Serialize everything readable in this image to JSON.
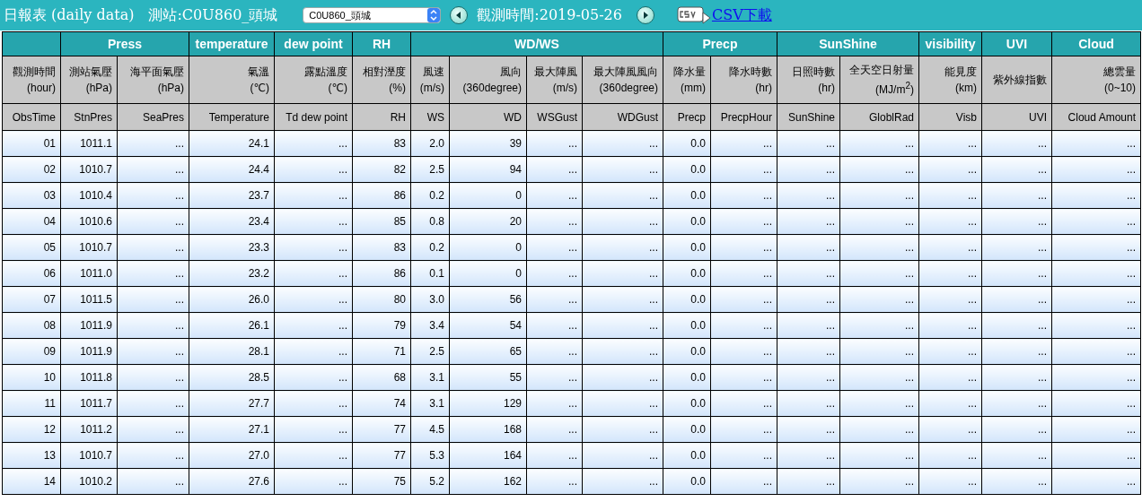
{
  "top_bar": {
    "title": "日報表 (daily data)",
    "station_label": "測站:C0U860_頭城",
    "station_select": {
      "value": "C0U860_頭城"
    },
    "date_label": "觀測時間:2019-05-26",
    "csv_link": "CSV下載"
  },
  "table": {
    "groups": [
      {
        "columns": [
          {
            "label": "觀測時間\n(hour)",
            "code": "ObsTime"
          }
        ]
      },
      {
        "label": "Press",
        "columns": [
          {
            "label": "測站氣壓\n(hPa)",
            "code": "StnPres"
          },
          {
            "label": "海平面氣壓\n(hPa)",
            "code": "SeaPres"
          }
        ]
      },
      {
        "label": "temperature",
        "columns": [
          {
            "label": "氣溫\n(℃)",
            "code": "Temperature"
          }
        ]
      },
      {
        "label": "dew point",
        "columns": [
          {
            "label": "露點溫度\n(℃)",
            "code": "Td dew point"
          }
        ]
      },
      {
        "label": "RH",
        "columns": [
          {
            "label": "相對溼度\n(%)",
            "code": "RH"
          }
        ]
      },
      {
        "label": "WD/WS",
        "columns": [
          {
            "label": "風速\n(m/s)",
            "code": "WS"
          },
          {
            "label": "風向\n(360degree)",
            "code": "WD"
          },
          {
            "label": "最大陣風\n(m/s)",
            "code": "WSGust"
          },
          {
            "label": "最大陣風風向\n(360degree)",
            "code": "WDGust"
          }
        ]
      },
      {
        "label": "Precp",
        "columns": [
          {
            "label": "降水量\n(mm)",
            "code": "Precp"
          },
          {
            "label": "降水時數\n(hr)",
            "code": "PrecpHour"
          }
        ]
      },
      {
        "label": "SunShine",
        "columns": [
          {
            "label": "日照時數\n(hr)",
            "code": "SunShine"
          },
          {
            "label": "全天空日射量\n(MJ/m$^{2}$)",
            "code": "GloblRad"
          }
        ]
      },
      {
        "label": "visibility",
        "columns": [
          {
            "label": "能見度\n(km)",
            "code": "Visb"
          }
        ]
      },
      {
        "label": "UVI",
        "columns": [
          {
            "label": "紫外線指數",
            "code": "UVI"
          }
        ]
      },
      {
        "label": "Cloud",
        "columns": [
          {
            "label": "總雲量\n(0~10)",
            "code": "Cloud Amount"
          }
        ]
      }
    ],
    "rows": [
      [
        "01",
        "1011.1",
        "...",
        "24.1",
        "...",
        "83",
        "2.0",
        "39",
        "...",
        "...",
        "0.0",
        "...",
        "...",
        "...",
        "...",
        "...",
        "..."
      ],
      [
        "02",
        "1010.7",
        "...",
        "24.4",
        "...",
        "82",
        "2.5",
        "94",
        "...",
        "...",
        "0.0",
        "...",
        "...",
        "...",
        "...",
        "...",
        "..."
      ],
      [
        "03",
        "1010.4",
        "...",
        "23.7",
        "...",
        "86",
        "0.2",
        "0",
        "...",
        "...",
        "0.0",
        "...",
        "...",
        "...",
        "...",
        "...",
        "..."
      ],
      [
        "04",
        "1010.6",
        "...",
        "23.4",
        "...",
        "85",
        "0.8",
        "20",
        "...",
        "...",
        "0.0",
        "...",
        "...",
        "...",
        "...",
        "...",
        "..."
      ],
      [
        "05",
        "1010.7",
        "...",
        "23.3",
        "...",
        "83",
        "0.2",
        "0",
        "...",
        "...",
        "0.0",
        "...",
        "...",
        "...",
        "...",
        "...",
        "..."
      ],
      [
        "06",
        "1011.0",
        "...",
        "23.2",
        "...",
        "86",
        "0.1",
        "0",
        "...",
        "...",
        "0.0",
        "...",
        "...",
        "...",
        "...",
        "...",
        "..."
      ],
      [
        "07",
        "1011.5",
        "...",
        "26.0",
        "...",
        "80",
        "3.0",
        "56",
        "...",
        "...",
        "0.0",
        "...",
        "...",
        "...",
        "...",
        "...",
        "..."
      ],
      [
        "08",
        "1011.9",
        "...",
        "26.1",
        "...",
        "79",
        "3.4",
        "54",
        "...",
        "...",
        "0.0",
        "...",
        "...",
        "...",
        "...",
        "...",
        "..."
      ],
      [
        "09",
        "1011.9",
        "...",
        "28.1",
        "...",
        "71",
        "2.5",
        "65",
        "...",
        "...",
        "0.0",
        "...",
        "...",
        "...",
        "...",
        "...",
        "..."
      ],
      [
        "10",
        "1011.8",
        "...",
        "28.5",
        "...",
        "68",
        "3.1",
        "55",
        "...",
        "...",
        "0.0",
        "...",
        "...",
        "...",
        "...",
        "...",
        "..."
      ],
      [
        "11",
        "1011.7",
        "...",
        "27.7",
        "...",
        "74",
        "3.1",
        "129",
        "...",
        "...",
        "0.0",
        "...",
        "...",
        "...",
        "...",
        "...",
        "..."
      ],
      [
        "12",
        "1011.2",
        "...",
        "27.1",
        "...",
        "77",
        "4.5",
        "168",
        "...",
        "...",
        "0.0",
        "...",
        "...",
        "...",
        "...",
        "...",
        "..."
      ],
      [
        "13",
        "1010.7",
        "...",
        "27.0",
        "...",
        "77",
        "5.3",
        "164",
        "...",
        "...",
        "0.0",
        "...",
        "...",
        "...",
        "...",
        "...",
        "..."
      ],
      [
        "14",
        "1010.2",
        "...",
        "27.6",
        "...",
        "75",
        "5.2",
        "162",
        "...",
        "...",
        "0.0",
        "...",
        "...",
        "...",
        "...",
        "...",
        "..."
      ]
    ]
  }
}
